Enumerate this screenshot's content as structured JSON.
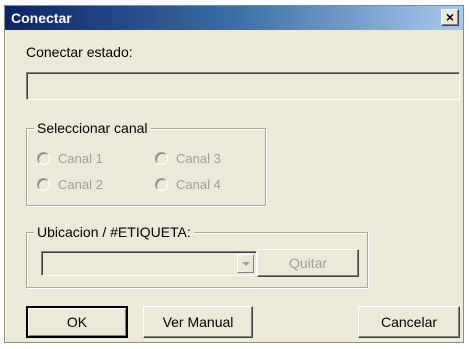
{
  "window": {
    "title": "Conectar",
    "close_label": "×"
  },
  "status": {
    "label": "Conectar estado:",
    "value": ""
  },
  "channels": {
    "group_label": "Seleccionar canal",
    "options": [
      {
        "label": "Canal 1",
        "checked": false,
        "enabled": false
      },
      {
        "label": "Canal 2",
        "checked": false,
        "enabled": false
      },
      {
        "label": "Canal 3",
        "checked": false,
        "enabled": false
      },
      {
        "label": "Canal 4",
        "checked": false,
        "enabled": false
      }
    ]
  },
  "location": {
    "group_label": "Ubicacion / #ETIQUETA:",
    "selected_value": "",
    "remove_label": "Quitar"
  },
  "buttons": {
    "ok": "OK",
    "manual": "Ver Manual",
    "cancel": "Cancelar"
  },
  "colors": {
    "title_bar_start": "#0a246a",
    "title_bar_end": "#a6caf0",
    "face": "#ece9d8",
    "disabled_text": "#a0a0a0"
  }
}
